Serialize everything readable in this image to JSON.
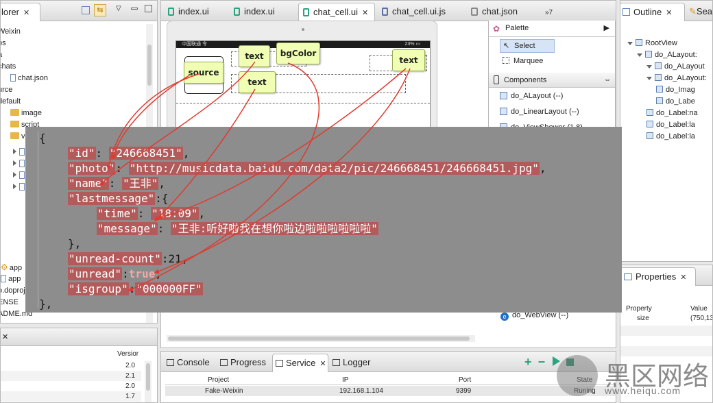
{
  "explorer": {
    "title": "lorer",
    "items": [
      {
        "label": "Weixin",
        "icon": "none",
        "depth": 0
      },
      {
        "label": "os",
        "icon": "none",
        "depth": 0
      },
      {
        "label": "a",
        "icon": "none",
        "depth": 0
      },
      {
        "label": "chats",
        "icon": "none",
        "depth": 0
      },
      {
        "label": "chat.json",
        "icon": "file",
        "depth": 1
      },
      {
        "label": "urce",
        "icon": "none",
        "depth": 0
      },
      {
        "label": "default",
        "icon": "none",
        "depth": 0
      },
      {
        "label": "image",
        "icon": "folder",
        "depth": 1
      },
      {
        "label": "script",
        "icon": "folder",
        "depth": 1
      },
      {
        "label": "view",
        "icon": "folder",
        "depth": 1
      }
    ],
    "lower_items": [
      "app",
      "app",
      "o.doproj",
      "ENSE",
      "ADME.md"
    ]
  },
  "bottom_left": {
    "header": "Versior",
    "values": [
      "2.0",
      "2.1",
      "2.0",
      "1.7"
    ]
  },
  "editor_tabs": [
    {
      "label": "index.ui",
      "icon": "ui"
    },
    {
      "label": "index.ui",
      "icon": "ui"
    },
    {
      "label": "chat_cell.ui",
      "icon": "ui",
      "active": true
    },
    {
      "label": "chat_cell.ui.js",
      "icon": "js"
    },
    {
      "label": "chat.json",
      "icon": "json"
    },
    {
      "label": "»7",
      "icon": "none"
    }
  ],
  "phone": {
    "status_left": "中国联通 令",
    "status_right": "23% ▭"
  },
  "annotations": {
    "source": "source",
    "text1": "text",
    "bgcolor": "bgColor",
    "text2": "text",
    "text3": "text"
  },
  "palette": {
    "title": "Palette",
    "select": "Select",
    "marquee": "Marquee",
    "components_title": "Components",
    "components": [
      "do_ALayout (--)",
      "do_LinearLayout (--)",
      "do_ViewShower (1.8)"
    ],
    "webview": "do_WebView (--)"
  },
  "outline": {
    "title": "Outline",
    "search_tab": "Sea",
    "items": [
      {
        "label": "RootView",
        "depth": 0
      },
      {
        "label": "do_ALayout:",
        "depth": 1
      },
      {
        "label": "do_ALayout",
        "depth": 2
      },
      {
        "label": "do_ALayout:",
        "depth": 2
      },
      {
        "label": "do_Imag",
        "depth": 3
      },
      {
        "label": "do_Labe",
        "depth": 3
      },
      {
        "label": "do_Label:na",
        "depth": 2
      },
      {
        "label": "do_Label:la",
        "depth": 2
      },
      {
        "label": "do_Label:la",
        "depth": 2
      }
    ]
  },
  "properties": {
    "title": "Properties",
    "col_property": "Property",
    "col_value": "Value",
    "rows": [
      {
        "property": "size",
        "value": "(750,13"
      }
    ]
  },
  "console": {
    "tabs": [
      "Console",
      "Progress",
      "Service",
      "Logger"
    ],
    "columns": [
      "Project",
      "IP",
      "Port",
      "State"
    ],
    "rows": [
      {
        "project": "Fake-Weixin",
        "ip": "192.168.1.104",
        "port": "9399",
        "state": "Runing"
      }
    ]
  },
  "code_lines": [
    [
      "{"
    ],
    [
      "\"id\"",
      ": ",
      "\"246668451\"",
      ","
    ],
    [
      "\"photo\"",
      ": ",
      "\"http://musicdata.baidu.com/data2/pic/246668451/246668451.jpg\"",
      ","
    ],
    [
      "\"name\"",
      ": ",
      "\"王非\"",
      ","
    ],
    [
      "\"lastmessage\"",
      ":{"
    ],
    [
      "\"time\"",
      ": ",
      "\"18:09\"",
      ","
    ],
    [
      "\"message\"",
      ": ",
      "\"王非:听好啦我在想你啦边啦啦啦啦啦啦\""
    ],
    [
      "},"
    ],
    [
      "\"unread-count\"",
      ":21,"
    ],
    [
      "\"unread\"",
      ":",
      "true",
      ","
    ],
    [
      "\"isgroup\"",
      ":",
      "\"000000FF\""
    ],
    [
      "},"
    ]
  ],
  "watermark": {
    "chinese": "黑区网络",
    "url": "www.heiqu.com"
  },
  "colors": {
    "code_bg": "#8d8d8d",
    "highlight": "#b35a5a",
    "arrow": "#e03a2e",
    "annotation": "#f1ffb5",
    "accent_green": "#2aa37f"
  }
}
